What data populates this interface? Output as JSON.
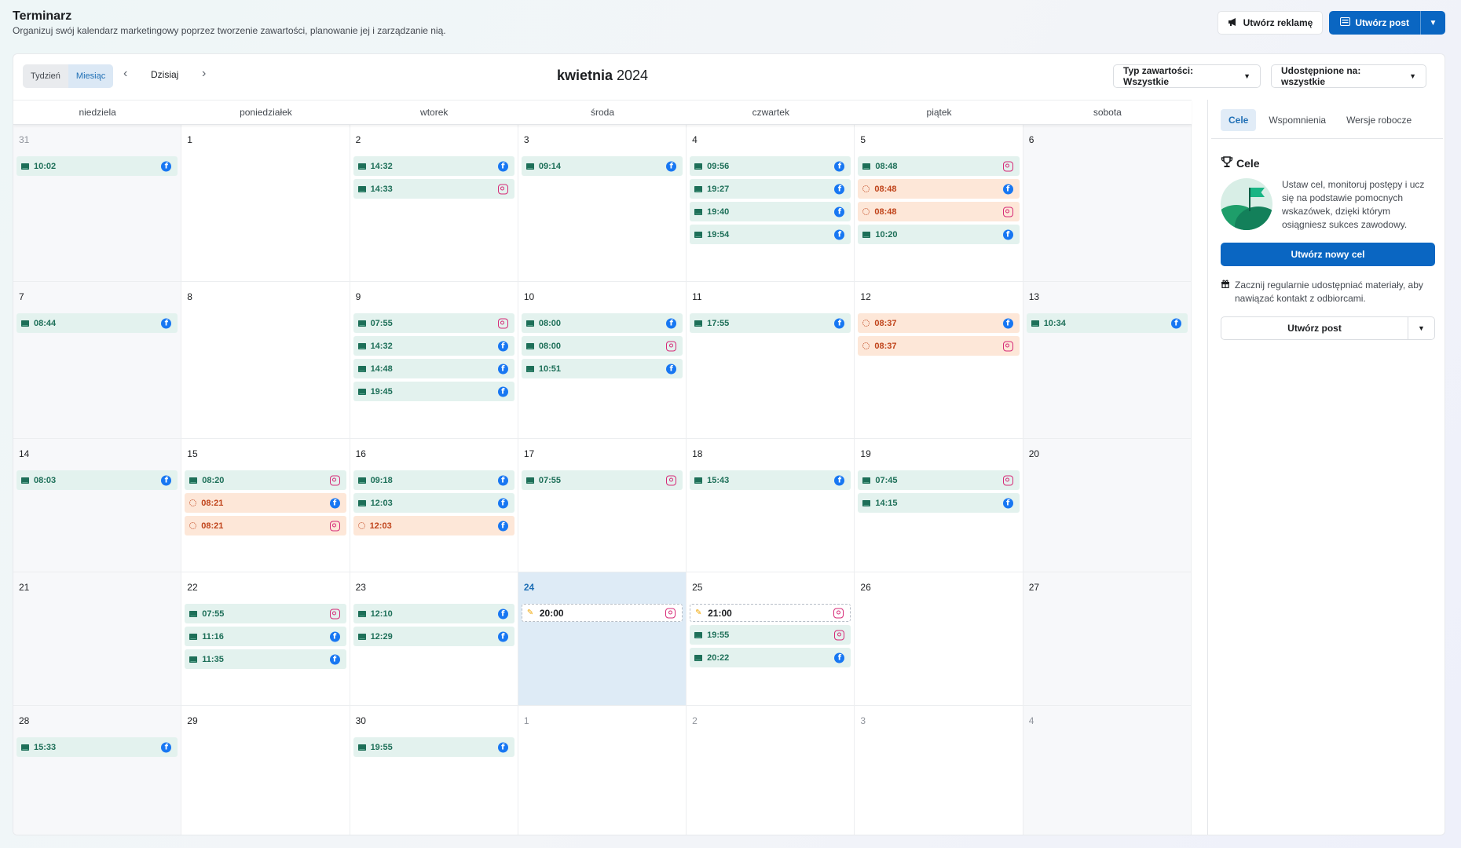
{
  "header": {
    "title": "Terminarz",
    "subtitle": "Organizuj swój kalendarz marketingowy poprzez tworzenie zawartości, planowanie jej i zarządzanie nią.",
    "create_ad": "Utwórz reklamę",
    "create_post": "Utwórz post"
  },
  "toolbar": {
    "week": "Tydzień",
    "month": "Miesiąc",
    "today": "Dzisiaj",
    "month_name": "kwietnia",
    "year": "2024",
    "type_filter": "Typ zawartości: Wszystkie",
    "share_filter": "Udostępnione na: wszystkie"
  },
  "weekdays": [
    "niedziela",
    "poniedziałek",
    "wtorek",
    "środa",
    "czwartek",
    "piątek",
    "sobota"
  ],
  "weeks": [
    {
      "days": [
        {
          "num": "31",
          "other": true,
          "weekend": true,
          "events": [
            {
              "time": "10:02",
              "status": "scheduled",
              "platform": "facebook"
            }
          ]
        },
        {
          "num": "1",
          "events": []
        },
        {
          "num": "2",
          "events": [
            {
              "time": "14:32",
              "status": "scheduled",
              "platform": "facebook"
            },
            {
              "time": "14:33",
              "status": "scheduled",
              "platform": "instagram"
            }
          ]
        },
        {
          "num": "3",
          "events": [
            {
              "time": "09:14",
              "status": "scheduled",
              "platform": "facebook"
            }
          ]
        },
        {
          "num": "4",
          "events": [
            {
              "time": "09:56",
              "status": "scheduled",
              "platform": "facebook"
            },
            {
              "time": "19:27",
              "status": "scheduled",
              "platform": "facebook"
            },
            {
              "time": "19:40",
              "status": "scheduled",
              "platform": "facebook"
            },
            {
              "time": "19:54",
              "status": "scheduled",
              "platform": "facebook"
            }
          ]
        },
        {
          "num": "5",
          "events": [
            {
              "time": "08:48",
              "status": "scheduled",
              "platform": "instagram"
            },
            {
              "time": "08:48",
              "status": "warning",
              "platform": "facebook"
            },
            {
              "time": "08:48",
              "status": "warning",
              "platform": "instagram"
            },
            {
              "time": "10:20",
              "status": "scheduled",
              "platform": "facebook"
            }
          ]
        },
        {
          "num": "6",
          "weekend": true,
          "events": []
        }
      ]
    },
    {
      "days": [
        {
          "num": "7",
          "weekend": true,
          "events": [
            {
              "time": "08:44",
              "status": "scheduled",
              "platform": "facebook"
            }
          ]
        },
        {
          "num": "8",
          "events": []
        },
        {
          "num": "9",
          "events": [
            {
              "time": "07:55",
              "status": "scheduled",
              "platform": "instagram"
            },
            {
              "time": "14:32",
              "status": "scheduled",
              "platform": "facebook"
            },
            {
              "time": "14:48",
              "status": "scheduled",
              "platform": "facebook"
            },
            {
              "time": "19:45",
              "status": "scheduled",
              "platform": "facebook"
            }
          ]
        },
        {
          "num": "10",
          "events": [
            {
              "time": "08:00",
              "status": "scheduled",
              "platform": "facebook"
            },
            {
              "time": "08:00",
              "status": "scheduled",
              "platform": "instagram"
            },
            {
              "time": "10:51",
              "status": "scheduled",
              "platform": "facebook"
            }
          ]
        },
        {
          "num": "11",
          "events": [
            {
              "time": "17:55",
              "status": "scheduled",
              "platform": "facebook"
            }
          ]
        },
        {
          "num": "12",
          "events": [
            {
              "time": "08:37",
              "status": "warning",
              "platform": "facebook"
            },
            {
              "time": "08:37",
              "status": "warning",
              "platform": "instagram"
            }
          ]
        },
        {
          "num": "13",
          "weekend": true,
          "events": [
            {
              "time": "10:34",
              "status": "scheduled",
              "platform": "facebook"
            }
          ]
        }
      ]
    },
    {
      "days": [
        {
          "num": "14",
          "weekend": true,
          "events": [
            {
              "time": "08:03",
              "status": "scheduled",
              "platform": "facebook"
            }
          ]
        },
        {
          "num": "15",
          "events": [
            {
              "time": "08:20",
              "status": "scheduled",
              "platform": "instagram"
            },
            {
              "time": "08:21",
              "status": "warning",
              "platform": "facebook"
            },
            {
              "time": "08:21",
              "status": "warning",
              "platform": "instagram"
            }
          ]
        },
        {
          "num": "16",
          "events": [
            {
              "time": "09:18",
              "status": "scheduled",
              "platform": "facebook"
            },
            {
              "time": "12:03",
              "status": "scheduled",
              "platform": "facebook"
            },
            {
              "time": "12:03",
              "status": "warning",
              "platform": "facebook"
            }
          ]
        },
        {
          "num": "17",
          "events": [
            {
              "time": "07:55",
              "status": "scheduled",
              "platform": "instagram"
            }
          ]
        },
        {
          "num": "18",
          "events": [
            {
              "time": "15:43",
              "status": "scheduled",
              "platform": "facebook"
            }
          ]
        },
        {
          "num": "19",
          "events": [
            {
              "time": "07:45",
              "status": "scheduled",
              "platform": "instagram"
            },
            {
              "time": "14:15",
              "status": "scheduled",
              "platform": "facebook"
            }
          ]
        },
        {
          "num": "20",
          "weekend": true,
          "events": []
        }
      ]
    },
    {
      "days": [
        {
          "num": "21",
          "weekend": true,
          "events": []
        },
        {
          "num": "22",
          "events": [
            {
              "time": "07:55",
              "status": "scheduled",
              "platform": "instagram"
            },
            {
              "time": "11:16",
              "status": "scheduled",
              "platform": "facebook"
            },
            {
              "time": "11:35",
              "status": "scheduled",
              "platform": "facebook"
            }
          ]
        },
        {
          "num": "23",
          "events": [
            {
              "time": "12:10",
              "status": "scheduled",
              "platform": "facebook"
            },
            {
              "time": "12:29",
              "status": "scheduled",
              "platform": "facebook"
            }
          ]
        },
        {
          "num": "24",
          "today": true,
          "events": [
            {
              "time": "20:00",
              "status": "planned",
              "platform": "instagram"
            }
          ]
        },
        {
          "num": "25",
          "events": [
            {
              "time": "21:00",
              "status": "planned",
              "platform": "instagram"
            },
            {
              "time": "19:55",
              "status": "scheduled",
              "platform": "instagram"
            },
            {
              "time": "20:22",
              "status": "scheduled",
              "platform": "facebook"
            }
          ]
        },
        {
          "num": "26",
          "events": []
        },
        {
          "num": "27",
          "weekend": true,
          "events": []
        }
      ]
    },
    {
      "days": [
        {
          "num": "28",
          "weekend": true,
          "events": [
            {
              "time": "15:33",
              "status": "scheduled",
              "platform": "facebook"
            }
          ]
        },
        {
          "num": "29",
          "events": []
        },
        {
          "num": "30",
          "events": [
            {
              "time": "19:55",
              "status": "scheduled",
              "platform": "facebook"
            }
          ]
        },
        {
          "num": "1",
          "other": true,
          "events": []
        },
        {
          "num": "2",
          "other": true,
          "events": []
        },
        {
          "num": "3",
          "other": true,
          "events": []
        },
        {
          "num": "4",
          "other": true,
          "weekend": true,
          "events": []
        }
      ]
    }
  ],
  "side": {
    "tabs": [
      "Cele",
      "Wspomnienia",
      "Wersje robocze"
    ],
    "goals_title": "Cele",
    "goals_text": "Ustaw cel, monitoruj postępy i ucz się na podstawie pomocnych wskazówek, dzięki którym osiągniesz sukces zawodowy.",
    "new_goal": "Utwórz nowy cel",
    "tip": "Zacznij regularnie udostępniać materiały, aby nawiązać kontakt z odbiorcami.",
    "create_post": "Utwórz post"
  },
  "colors": {
    "primary": "#0a66c2",
    "scheduled_bg": "#e3f2ee",
    "warning_bg": "#fde7d8",
    "today_bg": "#deebf6",
    "facebook": "#1877f2",
    "instagram": "#d62976"
  }
}
